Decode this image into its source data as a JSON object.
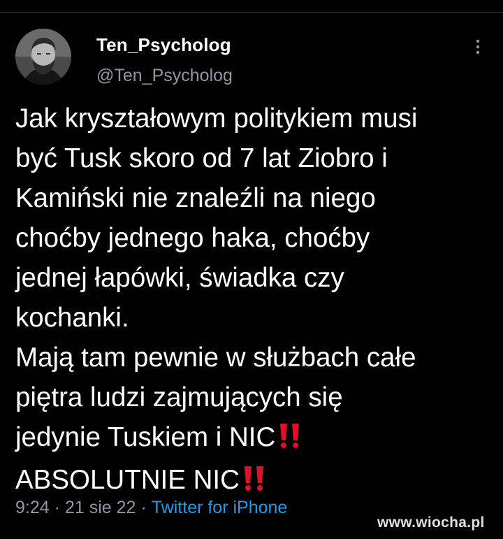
{
  "tweet": {
    "author": {
      "display_name": "Ten_Psycholog",
      "handle": "@Ten_Psycholog"
    },
    "more_icon": "more-vertical-icon",
    "text_lines": [
      "Jak kryształowym politykiem musi",
      "być Tusk skoro od 7 lat Ziobro i",
      "Kamiński nie znaleźli na niego",
      "choćby jednego haka, choćby",
      "jednej łapówki, świadka czy",
      "kochanki.",
      "Mają tam pewnie w służbach całe",
      "piętra ludzi zajmujących się",
      "jedynie Tuskiem i NIC",
      "ABSOLUTNIE NIC"
    ],
    "emoji": "double-exclamation-icon",
    "time": "9:24",
    "date": "21 sie 22",
    "separator": "·",
    "source": "Twitter for iPhone"
  },
  "watermark": "www.wiocha.pl",
  "colors": {
    "background": "#000000",
    "text": "#ffffff",
    "muted": "#8b98a5",
    "link": "#1d9bf0",
    "emoji_red": "#e0102a"
  }
}
